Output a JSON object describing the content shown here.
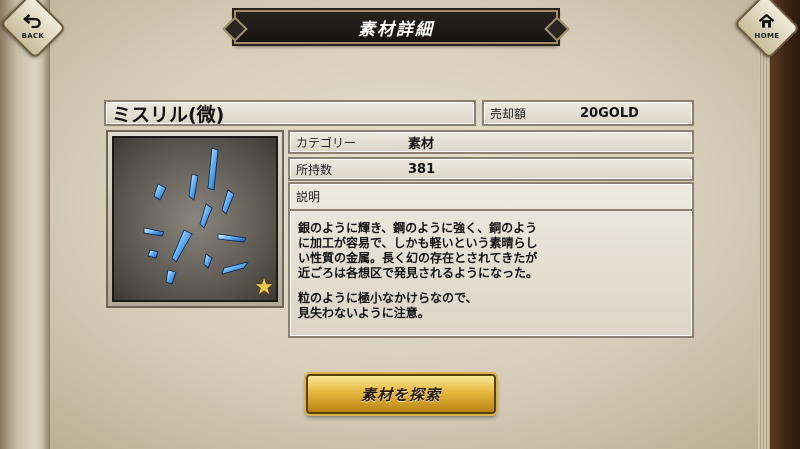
{
  "header": {
    "title": "素材詳細",
    "back_label": "BACK",
    "home_label": "HOME"
  },
  "item": {
    "name": "ミスリル(微)",
    "sell_label": "売却額",
    "sell_value": "20GOLD",
    "category_label": "カテゴリー",
    "category_value": "素材",
    "owned_label": "所持数",
    "owned_value": "381",
    "rarity_icon": "star-icon",
    "description_label": "説明",
    "description_lines": [
      "銀のように輝き、鋼のように強く、銅のよう",
      "に加工が容易で、しかも軽いという素晴らし",
      "い性質の金属。長く幻の存在とされてきたが",
      "近ごろは各想区で発見されるようになった。"
    ],
    "description_lines2": [
      "粒のように極小なかけらなので、",
      "見失わないように注意。"
    ]
  },
  "actions": {
    "search_label": "素材を探索"
  },
  "colors": {
    "accent_gold": "#e6b73c",
    "title_plate": "#141110",
    "star": "#f2c94c"
  }
}
